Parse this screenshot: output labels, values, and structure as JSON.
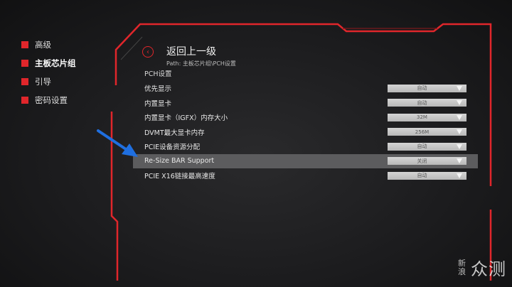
{
  "sidebar": {
    "items": [
      {
        "label": "高级",
        "active": false
      },
      {
        "label": "主板芯片组",
        "active": true
      },
      {
        "label": "引导",
        "active": false
      },
      {
        "label": "密码设置",
        "active": false
      }
    ]
  },
  "header": {
    "back_icon": "chevron-left-icon",
    "title": "返回上一级",
    "path": "Path: 主板芯片组\\PCH设置"
  },
  "section_title": "PCH设置",
  "settings": [
    {
      "label": "优先显示",
      "value": "自动",
      "selected": false
    },
    {
      "label": "内置显卡",
      "value": "自动",
      "selected": false
    },
    {
      "label": "内置显卡（IGFX）内存大小",
      "value": "32M",
      "selected": false
    },
    {
      "label": "DVMT最大显卡内存",
      "value": "256M",
      "selected": false
    },
    {
      "label": "PCIE设备资源分配",
      "value": "自动",
      "selected": false
    },
    {
      "label": "Re-Size BAR Support",
      "value": "关闭",
      "selected": true
    },
    {
      "label": "PCIE X16链接最高速度",
      "value": "自动",
      "selected": false
    }
  ],
  "watermark": {
    "small": "新浪",
    "big": "众测"
  },
  "colors": {
    "accent": "#e0262b",
    "arrow": "#1f6fe0",
    "selected_row": "#5c5c5e"
  }
}
